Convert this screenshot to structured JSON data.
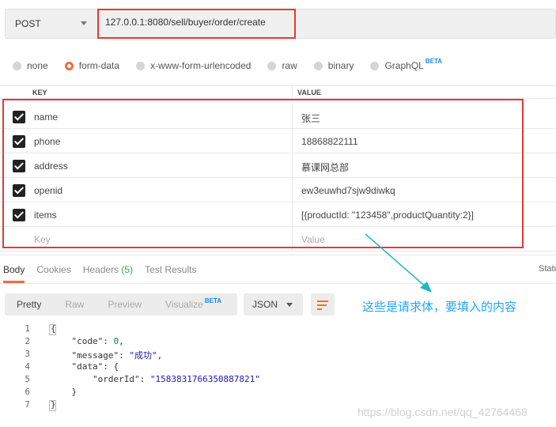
{
  "request": {
    "method": "POST",
    "url": "127.0.0.1:8080/sell/buyer/order/create"
  },
  "body_types": [
    {
      "label": "none",
      "selected": false
    },
    {
      "label": "form-data",
      "selected": true
    },
    {
      "label": "x-www-form-urlencoded",
      "selected": false
    },
    {
      "label": "raw",
      "selected": false
    },
    {
      "label": "binary",
      "selected": false
    },
    {
      "label": "GraphQL",
      "selected": false,
      "badge": "BETA"
    }
  ],
  "table": {
    "key_header": "KEY",
    "value_header": "VALUE",
    "rows": [
      {
        "key": "name",
        "value": "张三"
      },
      {
        "key": "phone",
        "value": "18868822111"
      },
      {
        "key": "address",
        "value": "慕课网总部"
      },
      {
        "key": "openid",
        "value": "ew3euwhd7sjw9diwkq"
      },
      {
        "key": "items",
        "value": "[{productId: \"123458\",productQuantity:2}]"
      }
    ],
    "placeholder_key": "Key",
    "placeholder_value": "Value"
  },
  "response_tabs": {
    "body": "Body",
    "cookies": "Cookies",
    "headers": "Headers",
    "headers_count": "(5)",
    "test_results": "Test Results",
    "status": "Statu"
  },
  "formats": {
    "pretty": "Pretty",
    "raw": "Raw",
    "preview": "Preview",
    "visualize": "Visualize",
    "visualize_badge": "BETA",
    "selected_language": "JSON"
  },
  "annotation": "这些是请求体，要填入的内容",
  "code": {
    "line_numbers": [
      "1",
      "2",
      "3",
      "4",
      "5",
      "6",
      "7"
    ],
    "l1": "{",
    "l2_key": "\"code\"",
    "l2_val": "0",
    "l3_key": "\"message\"",
    "l3_val": "\"成功\"",
    "l4_key": "\"data\"",
    "l5_key": "\"orderId\"",
    "l5_val": "\"1583831766350887821\"",
    "l6": "}",
    "l7": "}"
  },
  "watermark": "https://blog.csdn.net/qq_42764468",
  "colors": {
    "accent": "#f26b3a",
    "highlight_box": "#e53935",
    "annotation": "#1ea5ff"
  }
}
